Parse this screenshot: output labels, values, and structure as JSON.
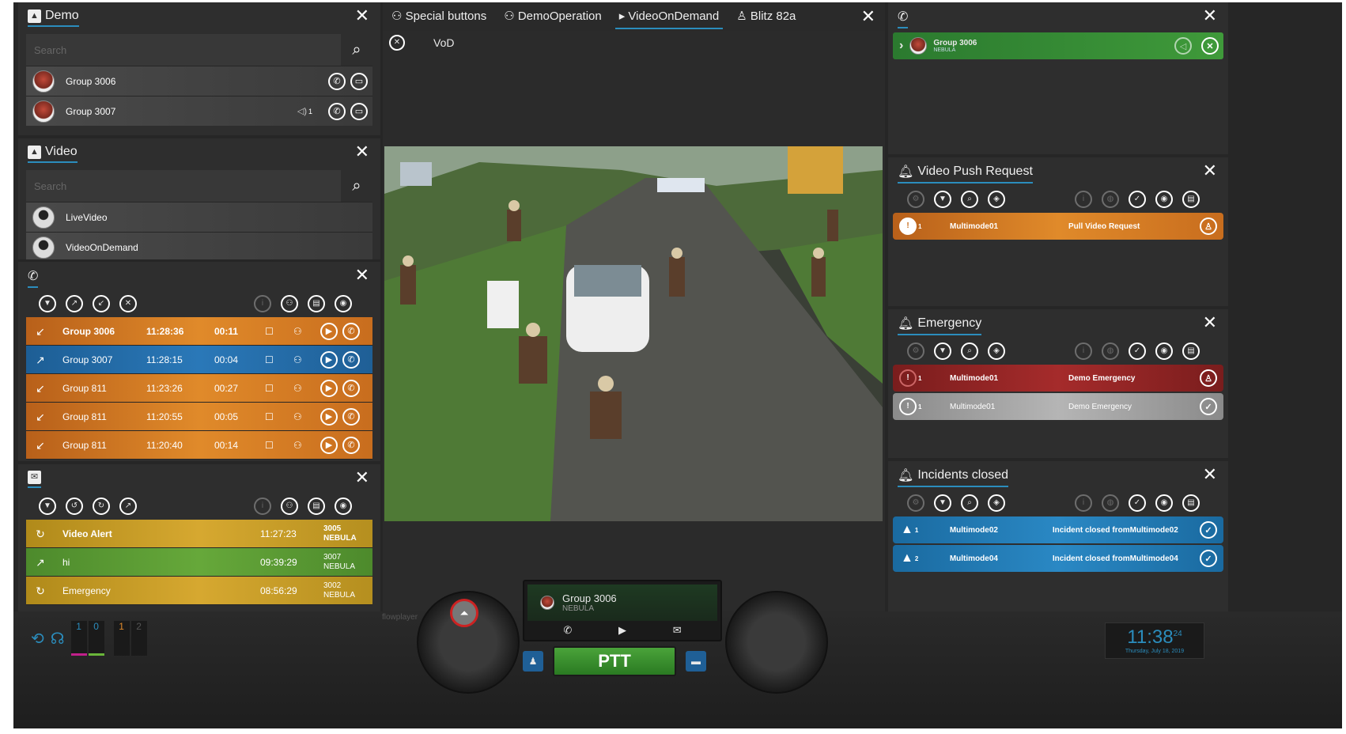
{
  "demo_panel": {
    "title": "Demo",
    "search_placeholder": "Search",
    "items": [
      {
        "label": "Group 3006",
        "badge": ""
      },
      {
        "label": "Group 3007",
        "badge": "1"
      }
    ]
  },
  "video_panel": {
    "title": "Video",
    "search_placeholder": "Search",
    "items": [
      {
        "label": "LiveVideo"
      },
      {
        "label": "VideoOnDemand"
      }
    ]
  },
  "calls_panel": {
    "rows": [
      {
        "name": "Group 3006",
        "time": "11:28:36",
        "dur": "00:11",
        "color": "orange",
        "bold": true
      },
      {
        "name": "Group 3007",
        "time": "11:28:15",
        "dur": "00:04",
        "color": "blue",
        "bold": false
      },
      {
        "name": "Group 811",
        "time": "11:23:26",
        "dur": "00:27",
        "color": "orange",
        "bold": false
      },
      {
        "name": "Group 811",
        "time": "11:20:55",
        "dur": "00:05",
        "color": "orange",
        "bold": false
      },
      {
        "name": "Group 811",
        "time": "11:20:40",
        "dur": "00:14",
        "color": "orange",
        "bold": false
      }
    ]
  },
  "messages_panel": {
    "rows": [
      {
        "name": "Video Alert",
        "time": "11:27:23",
        "from_id": "3005",
        "from_org": "NEBULA",
        "color": "yellow",
        "bold": true
      },
      {
        "name": "hi",
        "time": "09:39:29",
        "from_id": "3007",
        "from_org": "NEBULA",
        "color": "green",
        "bold": false
      },
      {
        "name": "Emergency",
        "time": "08:56:29",
        "from_id": "3002",
        "from_org": "NEBULA",
        "color": "yellow",
        "bold": false
      }
    ]
  },
  "tabs": [
    {
      "label": "Special buttons",
      "icon": "group-icon"
    },
    {
      "label": "DemoOperation",
      "icon": "group-icon"
    },
    {
      "label": "VideoOnDemand",
      "icon": "video-icon"
    },
    {
      "label": "Blitz 82a",
      "icon": "person-icon"
    }
  ],
  "vod": {
    "label": "VoD"
  },
  "active_call": {
    "group": "Group 3006",
    "org": "NEBULA"
  },
  "video_push": {
    "title": "Video Push Request",
    "rows": [
      {
        "user": "Multimode01",
        "text": "Pull Video Request",
        "count": "1"
      }
    ]
  },
  "emergency": {
    "title": "Emergency",
    "rows": [
      {
        "user": "Multimode01",
        "text": "Demo Emergency",
        "count": "1",
        "color": "red"
      },
      {
        "user": "Multimode01",
        "text": "Demo Emergency",
        "count": "1",
        "color": "gray"
      }
    ]
  },
  "incidents": {
    "title": "Incidents closed",
    "rows": [
      {
        "user": "Multimode02",
        "text": "Incident closed fromMultimode02",
        "count": "1"
      },
      {
        "user": "Multimode04",
        "text": "Incident closed fromMultimode04",
        "count": "2"
      }
    ]
  },
  "console": {
    "group": "Group 3006",
    "org": "NEBULA",
    "ptt": "PTT",
    "watermark": "flowplayer"
  },
  "audio": {
    "ch1": "1",
    "ch0": "0",
    "ch1b": "1",
    "ch2": "2"
  },
  "clock": {
    "time": "11:38",
    "seconds": "24",
    "date": "Thursday, July 18, 2019"
  }
}
